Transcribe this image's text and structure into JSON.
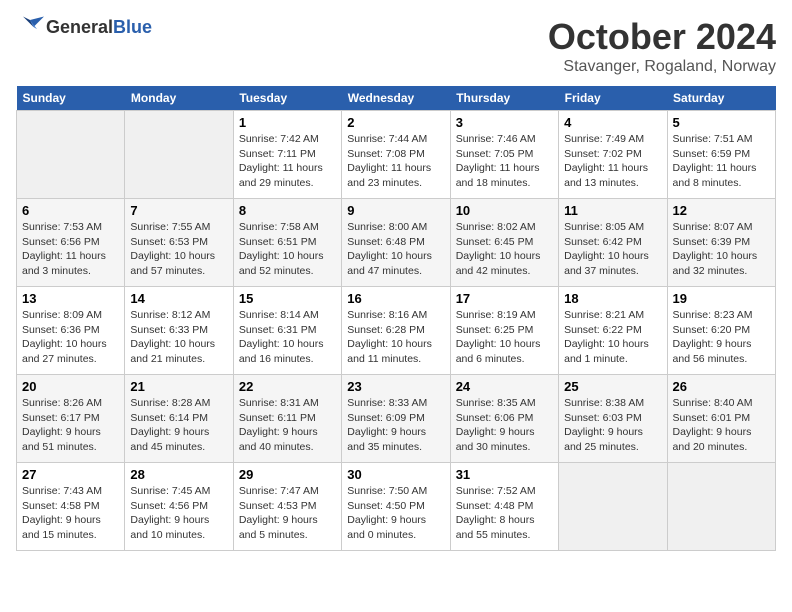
{
  "header": {
    "logo_general": "General",
    "logo_blue": "Blue",
    "month_title": "October 2024",
    "subtitle": "Stavanger, Rogaland, Norway"
  },
  "days_of_week": [
    "Sunday",
    "Monday",
    "Tuesday",
    "Wednesday",
    "Thursday",
    "Friday",
    "Saturday"
  ],
  "weeks": [
    [
      {
        "day": "",
        "info": ""
      },
      {
        "day": "",
        "info": ""
      },
      {
        "day": "1",
        "info": "Sunrise: 7:42 AM\nSunset: 7:11 PM\nDaylight: 11 hours and 29 minutes."
      },
      {
        "day": "2",
        "info": "Sunrise: 7:44 AM\nSunset: 7:08 PM\nDaylight: 11 hours and 23 minutes."
      },
      {
        "day": "3",
        "info": "Sunrise: 7:46 AM\nSunset: 7:05 PM\nDaylight: 11 hours and 18 minutes."
      },
      {
        "day": "4",
        "info": "Sunrise: 7:49 AM\nSunset: 7:02 PM\nDaylight: 11 hours and 13 minutes."
      },
      {
        "day": "5",
        "info": "Sunrise: 7:51 AM\nSunset: 6:59 PM\nDaylight: 11 hours and 8 minutes."
      }
    ],
    [
      {
        "day": "6",
        "info": "Sunrise: 7:53 AM\nSunset: 6:56 PM\nDaylight: 11 hours and 3 minutes."
      },
      {
        "day": "7",
        "info": "Sunrise: 7:55 AM\nSunset: 6:53 PM\nDaylight: 10 hours and 57 minutes."
      },
      {
        "day": "8",
        "info": "Sunrise: 7:58 AM\nSunset: 6:51 PM\nDaylight: 10 hours and 52 minutes."
      },
      {
        "day": "9",
        "info": "Sunrise: 8:00 AM\nSunset: 6:48 PM\nDaylight: 10 hours and 47 minutes."
      },
      {
        "day": "10",
        "info": "Sunrise: 8:02 AM\nSunset: 6:45 PM\nDaylight: 10 hours and 42 minutes."
      },
      {
        "day": "11",
        "info": "Sunrise: 8:05 AM\nSunset: 6:42 PM\nDaylight: 10 hours and 37 minutes."
      },
      {
        "day": "12",
        "info": "Sunrise: 8:07 AM\nSunset: 6:39 PM\nDaylight: 10 hours and 32 minutes."
      }
    ],
    [
      {
        "day": "13",
        "info": "Sunrise: 8:09 AM\nSunset: 6:36 PM\nDaylight: 10 hours and 27 minutes."
      },
      {
        "day": "14",
        "info": "Sunrise: 8:12 AM\nSunset: 6:33 PM\nDaylight: 10 hours and 21 minutes."
      },
      {
        "day": "15",
        "info": "Sunrise: 8:14 AM\nSunset: 6:31 PM\nDaylight: 10 hours and 16 minutes."
      },
      {
        "day": "16",
        "info": "Sunrise: 8:16 AM\nSunset: 6:28 PM\nDaylight: 10 hours and 11 minutes."
      },
      {
        "day": "17",
        "info": "Sunrise: 8:19 AM\nSunset: 6:25 PM\nDaylight: 10 hours and 6 minutes."
      },
      {
        "day": "18",
        "info": "Sunrise: 8:21 AM\nSunset: 6:22 PM\nDaylight: 10 hours and 1 minute."
      },
      {
        "day": "19",
        "info": "Sunrise: 8:23 AM\nSunset: 6:20 PM\nDaylight: 9 hours and 56 minutes."
      }
    ],
    [
      {
        "day": "20",
        "info": "Sunrise: 8:26 AM\nSunset: 6:17 PM\nDaylight: 9 hours and 51 minutes."
      },
      {
        "day": "21",
        "info": "Sunrise: 8:28 AM\nSunset: 6:14 PM\nDaylight: 9 hours and 45 minutes."
      },
      {
        "day": "22",
        "info": "Sunrise: 8:31 AM\nSunset: 6:11 PM\nDaylight: 9 hours and 40 minutes."
      },
      {
        "day": "23",
        "info": "Sunrise: 8:33 AM\nSunset: 6:09 PM\nDaylight: 9 hours and 35 minutes."
      },
      {
        "day": "24",
        "info": "Sunrise: 8:35 AM\nSunset: 6:06 PM\nDaylight: 9 hours and 30 minutes."
      },
      {
        "day": "25",
        "info": "Sunrise: 8:38 AM\nSunset: 6:03 PM\nDaylight: 9 hours and 25 minutes."
      },
      {
        "day": "26",
        "info": "Sunrise: 8:40 AM\nSunset: 6:01 PM\nDaylight: 9 hours and 20 minutes."
      }
    ],
    [
      {
        "day": "27",
        "info": "Sunrise: 7:43 AM\nSunset: 4:58 PM\nDaylight: 9 hours and 15 minutes."
      },
      {
        "day": "28",
        "info": "Sunrise: 7:45 AM\nSunset: 4:56 PM\nDaylight: 9 hours and 10 minutes."
      },
      {
        "day": "29",
        "info": "Sunrise: 7:47 AM\nSunset: 4:53 PM\nDaylight: 9 hours and 5 minutes."
      },
      {
        "day": "30",
        "info": "Sunrise: 7:50 AM\nSunset: 4:50 PM\nDaylight: 9 hours and 0 minutes."
      },
      {
        "day": "31",
        "info": "Sunrise: 7:52 AM\nSunset: 4:48 PM\nDaylight: 8 hours and 55 minutes."
      },
      {
        "day": "",
        "info": ""
      },
      {
        "day": "",
        "info": ""
      }
    ]
  ]
}
